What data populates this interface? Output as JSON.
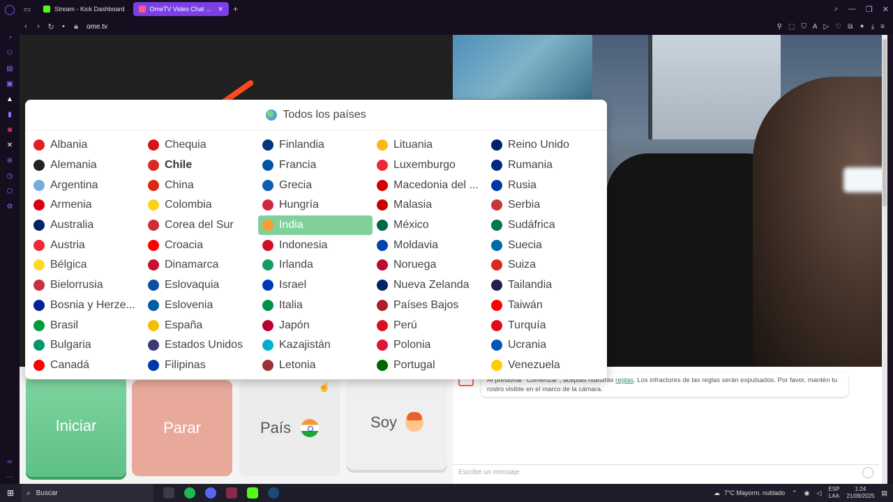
{
  "browser": {
    "tabs": [
      {
        "label": "Stream - Kick Dashboard",
        "color": "#53fc18",
        "active": false
      },
      {
        "label": "OmeTV Video Chat ...",
        "color": "#ff5a8a",
        "active": true
      }
    ],
    "url": "ome.tv"
  },
  "popup": {
    "title": "Todos los países",
    "columns": [
      [
        "Albania",
        "Alemania",
        "Argentina",
        "Armenia",
        "Australia",
        "Austria",
        "Bélgica",
        "Bielorrusia",
        "Bosnia y Herze...",
        "Brasil",
        "Bulgaria",
        "Canadá"
      ],
      [
        "Chequia",
        "Chile",
        "China",
        "Colombia",
        "Corea del Sur",
        "Croacia",
        "Dinamarca",
        "Eslovaquia",
        "Eslovenia",
        "España",
        "Estados Unidos",
        "Filipinas"
      ],
      [
        "Finlandia",
        "Francia",
        "Grecia",
        "Hungría",
        "India",
        "Indonesia",
        "Irlanda",
        "Israel",
        "Italia",
        "Japón",
        "Kazajistán",
        "Letonia"
      ],
      [
        "Lituania",
        "Luxemburgo",
        "Macedonia del ...",
        "Malasia",
        "México",
        "Moldavia",
        "Noruega",
        "Nueva Zelanda",
        "Países Bajos",
        "Perú",
        "Polonia",
        "Portugal"
      ],
      [
        "Reino Unido",
        "Rumania",
        "Rusia",
        "Serbia",
        "Sudáfrica",
        "Suecia",
        "Suiza",
        "Tailandia",
        "Taiwán",
        "Turquía",
        "Ucrania",
        "Venezuela"
      ]
    ],
    "flag_colors": [
      [
        "#e41e20",
        "#222222",
        "#74acdf",
        "#d90012",
        "#012169",
        "#ed2939",
        "#fdda24",
        "#c8313e",
        "#002395",
        "#009c3b",
        "#00966e",
        "#ff0000"
      ],
      [
        "#d7141a",
        "#d52b1e",
        "#de2910",
        "#fcd116",
        "#cd2e3a",
        "#ff0000",
        "#c8102e",
        "#0b4ea2",
        "#005da4",
        "#f1bf00",
        "#3c3b6e",
        "#0038a8"
      ],
      [
        "#003580",
        "#0055a4",
        "#0d5eaf",
        "#cd2a3e",
        "#ff9933",
        "#ce1126",
        "#169b62",
        "#0038b8",
        "#009246",
        "#bc002d",
        "#00afca",
        "#9e3039"
      ],
      [
        "#fdb913",
        "#ed2939",
        "#d20000",
        "#cc0001",
        "#006847",
        "#0046ae",
        "#ba0c2f",
        "#012169",
        "#ae1c28",
        "#d91023",
        "#dc143c",
        "#006600"
      ],
      [
        "#012169",
        "#002b7f",
        "#0039a6",
        "#c6363c",
        "#007749",
        "#006aa7",
        "#da291c",
        "#241d4f",
        "#fe0000",
        "#e30a17",
        "#0057b7",
        "#ffcc00"
      ]
    ],
    "bold_item": "Chile",
    "selected_item": "India"
  },
  "controls": {
    "start": "Iniciar",
    "stop": "Parar",
    "country": "País",
    "me": "Soy"
  },
  "chat": {
    "notice_before": "Al presionar \"Comenzar\", aceptas nuestras ",
    "notice_link": "reglas",
    "notice_after": ". Los infractores de las reglas serán expulsados. Por favor, mantén tu rostro visible en el marco de la cámara.",
    "input_placeholder": "Escribe un mensaje"
  },
  "taskbar": {
    "search": "Buscar",
    "weather": "7°C  Mayorm. nublado",
    "lang_top": "ESP",
    "lang_bottom": "LAA",
    "time": "1:24",
    "date": "21/09/2025"
  }
}
